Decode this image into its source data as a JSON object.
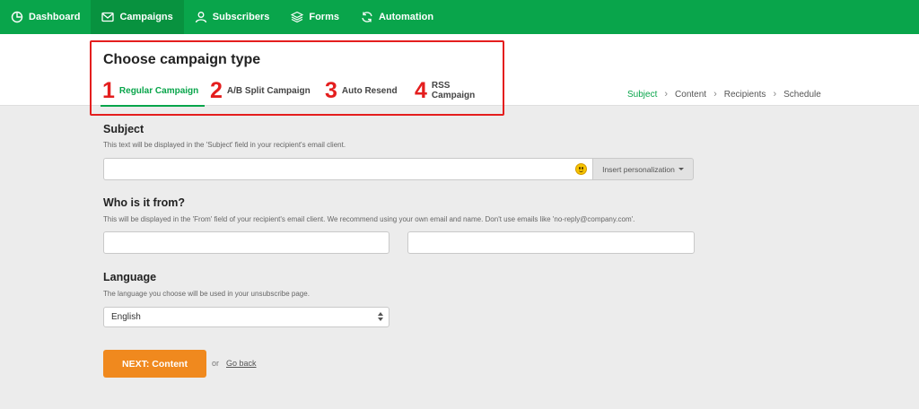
{
  "nav": {
    "items": [
      {
        "label": "Dashboard",
        "icon": "pie-chart-icon"
      },
      {
        "label": "Campaigns",
        "icon": "envelope-icon",
        "active": true
      },
      {
        "label": "Subscribers",
        "icon": "user-icon"
      },
      {
        "label": "Forms",
        "icon": "layers-icon"
      },
      {
        "label": "Automation",
        "icon": "refresh-icon"
      }
    ]
  },
  "header": {
    "title": "Choose campaign type",
    "tabs": [
      {
        "number": "1",
        "label": "Regular Campaign",
        "active": true
      },
      {
        "number": "2",
        "label": "A/B Split Campaign"
      },
      {
        "number": "3",
        "label": "Auto Resend"
      },
      {
        "number": "4",
        "label": "RSS Campaign"
      }
    ],
    "breadcrumb": [
      "Subject",
      "Content",
      "Recipients",
      "Schedule"
    ]
  },
  "subject": {
    "title": "Subject",
    "help": "This text will be displayed in the 'Subject' field in your recipient's email client.",
    "value": "",
    "personalize_label": "Insert personalization"
  },
  "from": {
    "title": "Who is it from?",
    "help": "This will be displayed in the 'From' field of your recipient's email client. We recommend using your own email and name. Don't use emails like 'no-reply@company.com'.",
    "name_value": "",
    "email_value": ""
  },
  "language": {
    "title": "Language",
    "help": "The language you choose will be used in your unsubscribe page.",
    "selected": "English"
  },
  "actions": {
    "next_label": "NEXT: Content",
    "or": "or",
    "back_label": "Go back"
  },
  "colors": {
    "brand_green": "#09a54b",
    "annotation_red": "#e41e1e",
    "cta_orange": "#f0891e"
  }
}
